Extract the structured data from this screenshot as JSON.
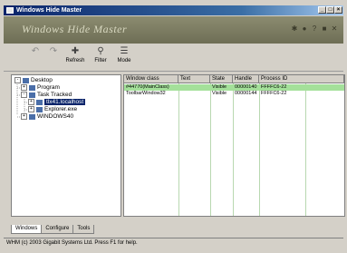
{
  "window": {
    "title": "Windows Hide Master",
    "buttons": [
      "_",
      "□",
      "×"
    ]
  },
  "banner": {
    "title": "Windows Hide Master",
    "icons": [
      "gear-icon",
      "info-icon",
      "help-icon",
      "minimize-icon",
      "close-icon"
    ]
  },
  "toolbar": {
    "items": [
      {
        "label": "",
        "icon": "back-icon"
      },
      {
        "label": "",
        "icon": "forward-icon"
      },
      {
        "label": "Refresh",
        "icon": "refresh-icon"
      },
      {
        "label": "Filter",
        "icon": "filter-icon"
      },
      {
        "label": "Mode",
        "icon": "mode-icon"
      }
    ]
  },
  "tree": {
    "nodes": [
      {
        "label": "Desktop",
        "toggle": "-"
      },
      {
        "label": "Program",
        "toggle": "+"
      },
      {
        "label": "Task Tracked",
        "toggle": "-"
      },
      {
        "label": "tlx41.localhost",
        "toggle": "+",
        "selected": true
      },
      {
        "label": "Explorer.exe",
        "toggle": "+"
      },
      {
        "label": "WINDOWS40",
        "toggle": "+"
      }
    ]
  },
  "grid": {
    "columns": [
      "Window class",
      "Text",
      "State",
      "Handle",
      "Process ID"
    ],
    "rows": [
      {
        "cells": [
          "#44770(MainClass)",
          "",
          "Visible",
          "00000140",
          "FFFFC6-22"
        ],
        "selected": true
      },
      {
        "cells": [
          "ToolbarWindow32",
          "",
          "Visible",
          "00000144",
          "FFFFC6-22"
        ],
        "selected": false
      }
    ]
  },
  "tabs": [
    "Windows",
    "Configure",
    "Tools"
  ],
  "status": {
    "text": "WHM (c) 2003 Gigabit Systems Ltd. Press F1 for help."
  }
}
